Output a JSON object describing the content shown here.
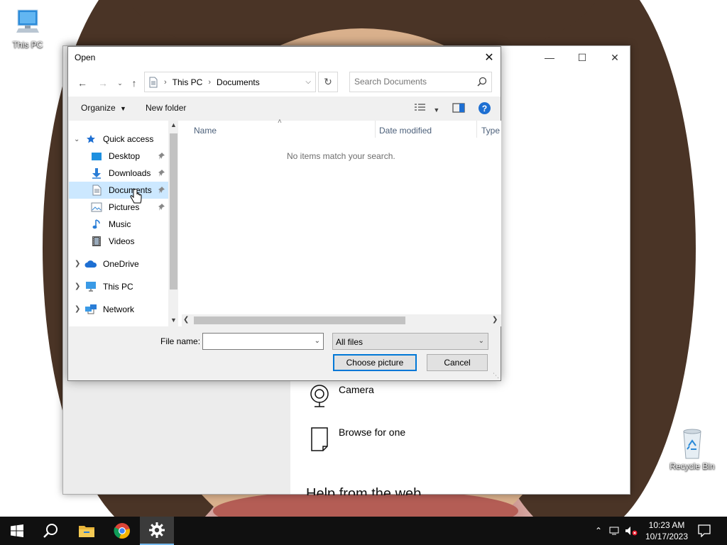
{
  "desktop": {
    "icons": [
      {
        "label": "This PC"
      },
      {
        "label": "Recycle Bin"
      }
    ]
  },
  "background_window": {
    "options": [
      {
        "label": "Camera"
      },
      {
        "label": "Browse for one"
      }
    ],
    "partial_heading": "Help from the web"
  },
  "dialog": {
    "title": "Open",
    "breadcrumb": [
      "This PC",
      "Documents"
    ],
    "search_placeholder": "Search Documents",
    "toolbar": {
      "organize": "Organize",
      "new_folder": "New folder"
    },
    "nav_tree": {
      "quick_access": "Quick access",
      "quick_items": [
        {
          "label": "Desktop",
          "pinned": true
        },
        {
          "label": "Downloads",
          "pinned": true
        },
        {
          "label": "Documents",
          "pinned": true,
          "selected": true
        },
        {
          "label": "Pictures",
          "pinned": true
        },
        {
          "label": "Music",
          "pinned": false
        },
        {
          "label": "Videos",
          "pinned": false
        }
      ],
      "onedrive": "OneDrive",
      "this_pc": "This PC",
      "network": "Network"
    },
    "columns": [
      "Name",
      "Date modified",
      "Type"
    ],
    "empty_message": "No items match your search.",
    "file_name_label": "File name:",
    "file_name_value": "",
    "file_type": "All files",
    "buttons": {
      "choose": "Choose picture",
      "cancel": "Cancel"
    }
  },
  "taskbar": {
    "time": "10:23 AM",
    "date": "10/17/2023"
  },
  "colors": {
    "accent": "#0078d7",
    "selection": "#cce8ff",
    "taskbar": "#101010"
  }
}
